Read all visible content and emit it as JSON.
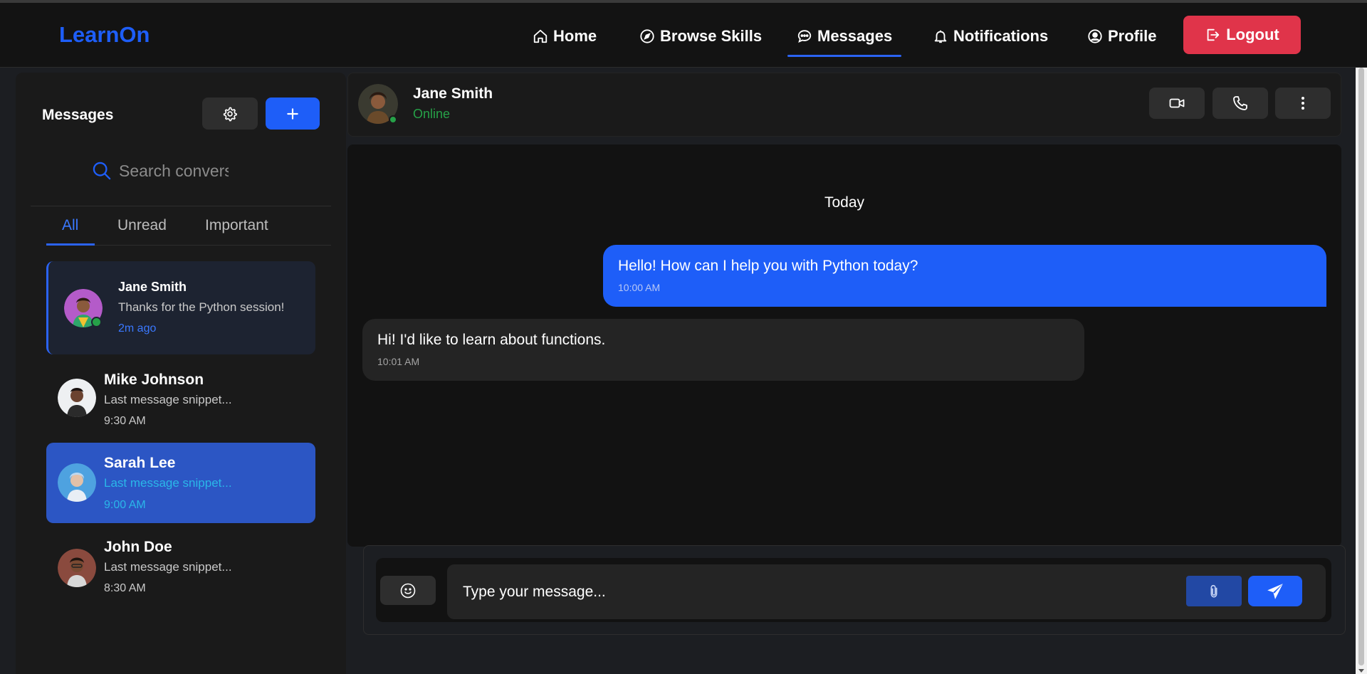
{
  "app": {
    "logo": "LearnOn"
  },
  "nav": {
    "items": [
      {
        "label": "Home",
        "icon": "home-icon"
      },
      {
        "label": "Browse Skills",
        "icon": "compass-icon"
      },
      {
        "label": "Messages",
        "icon": "chat-icon",
        "active": true
      },
      {
        "label": "Notifications",
        "icon": "bell-icon"
      },
      {
        "label": "Profile",
        "icon": "user-circle-icon"
      }
    ],
    "logout": "Logout"
  },
  "sidebar": {
    "title": "Messages",
    "search_placeholder": "Search conversations",
    "tabs": [
      "All",
      "Unread",
      "Important"
    ],
    "active_tab": "All",
    "conversations": [
      {
        "name": "Jane Smith",
        "snippet": "Thanks for the Python session!",
        "time": "2m ago",
        "online": true,
        "active": true
      },
      {
        "name": "Mike Johnson",
        "snippet": "Last message snippet...",
        "time": "9:30 AM"
      },
      {
        "name": "Sarah Lee",
        "snippet": "Last message snippet...",
        "time": "9:00 AM",
        "selected": true
      },
      {
        "name": "John Doe",
        "snippet": "Last message snippet...",
        "time": "8:30 AM"
      }
    ]
  },
  "chat": {
    "contact_name": "Jane Smith",
    "status": "Online",
    "day_label": "Today",
    "messages": [
      {
        "direction": "out",
        "text": "Hello! How can I help you with Python today?",
        "time": "10:00 AM"
      },
      {
        "direction": "in",
        "text": "Hi! I'd like to learn about functions.",
        "time": "10:01 AM"
      }
    ],
    "input_placeholder": "Type your message..."
  },
  "colors": {
    "accent": "#1e5ef8",
    "logout": "#e0344a",
    "online": "#26a148",
    "background": "#1c1e22",
    "panel": "#1a1a1a"
  }
}
